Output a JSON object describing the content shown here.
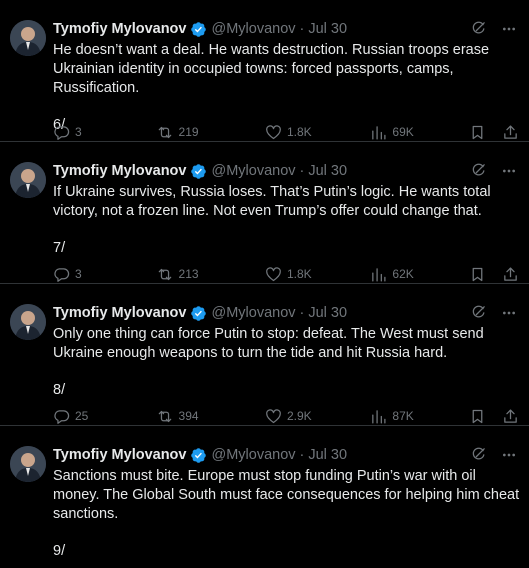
{
  "author": {
    "name": "Tymofiy Mylovanov",
    "handle": "@Mylovanov",
    "dot": "·"
  },
  "colors": {
    "verified": "#1d9bf0",
    "muted": "#71767b",
    "text": "#e7e9ea"
  },
  "tweets": [
    {
      "date": "Jul 30",
      "text": "He doesn’t want a deal. He wants destruction. Russian troops erase Ukrainian identity in occupied towns: forced passports, camps, Russification.",
      "number": "6/",
      "replies": "3",
      "retweets": "219",
      "likes": "1.8K",
      "views": "69K"
    },
    {
      "date": "Jul 30",
      "text": "If Ukraine survives, Russia loses. That’s Putin’s logic. He wants total victory, not a frozen line. Not even Trump’s offer could change that.",
      "number": "7/",
      "replies": "3",
      "retweets": "213",
      "likes": "1.8K",
      "views": "62K"
    },
    {
      "date": "Jul 30",
      "text": "Only one thing can force Putin to stop: defeat. The West must send Ukraine enough weapons to turn the tide and hit Russia hard.",
      "number": "8/",
      "replies": "25",
      "retweets": "394",
      "likes": "2.9K",
      "views": "87K"
    },
    {
      "date": "Jul 30",
      "text": "Sanctions must bite. Europe must stop funding Putin’s war with oil money. The Global South must face consequences for helping him cheat sanctions.",
      "number": "9/"
    }
  ]
}
